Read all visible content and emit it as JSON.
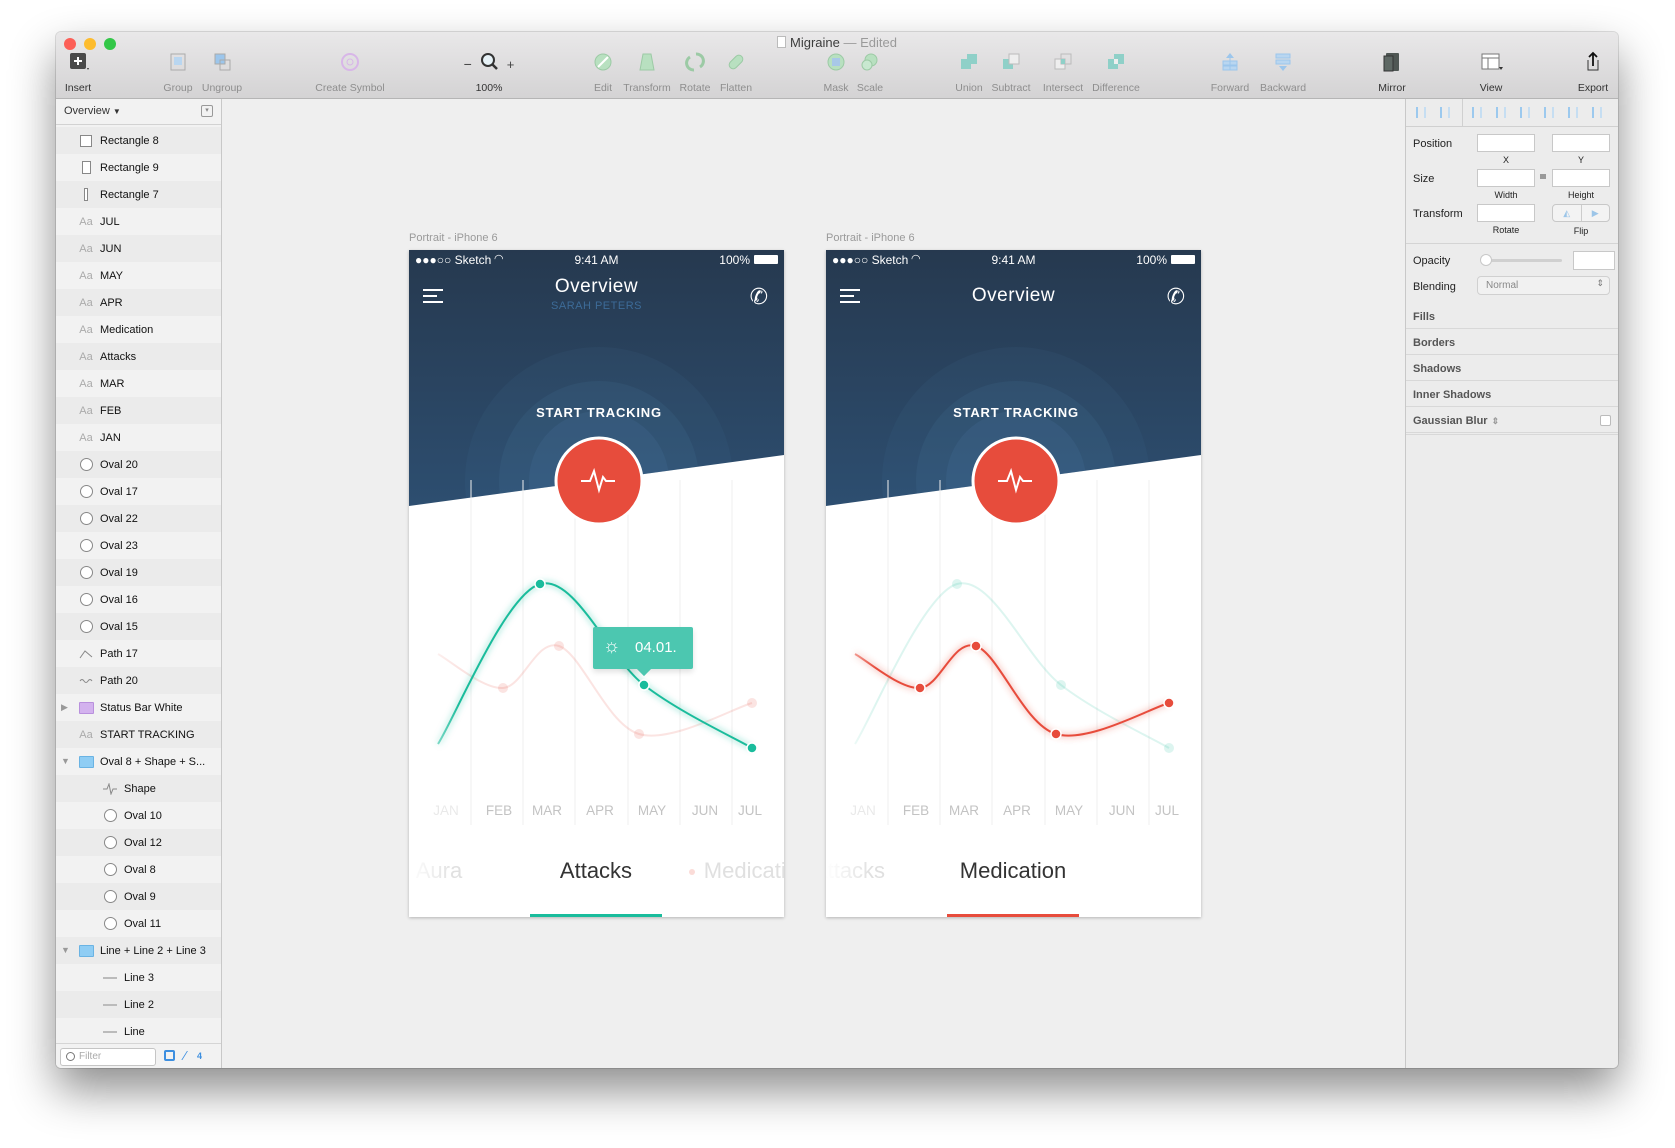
{
  "window": {
    "title": "Migraine",
    "status": "Edited",
    "separator": "—"
  },
  "toolbar": {
    "items": [
      {
        "label": "Insert",
        "icon": "insert-plus-icon",
        "enabled": true
      },
      {
        "label": "Group",
        "icon": "group-icon",
        "enabled": false
      },
      {
        "label": "Ungroup",
        "icon": "ungroup-icon",
        "enabled": false
      },
      {
        "label": "Create Symbol",
        "icon": "create-symbol-icon",
        "enabled": false
      },
      {
        "label": "100%",
        "icon": "zoom-icon",
        "enabled": true
      },
      {
        "label": "Edit",
        "icon": "edit-icon",
        "enabled": false
      },
      {
        "label": "Transform",
        "icon": "transform-icon",
        "enabled": false
      },
      {
        "label": "Rotate",
        "icon": "rotate-icon",
        "enabled": false
      },
      {
        "label": "Flatten",
        "icon": "flatten-icon",
        "enabled": false
      },
      {
        "label": "Mask",
        "icon": "mask-icon",
        "enabled": false
      },
      {
        "label": "Scale",
        "icon": "scale-icon",
        "enabled": false
      },
      {
        "label": "Union",
        "icon": "union-icon",
        "enabled": false
      },
      {
        "label": "Subtract",
        "icon": "subtract-icon",
        "enabled": false
      },
      {
        "label": "Intersect",
        "icon": "intersect-icon",
        "enabled": false
      },
      {
        "label": "Difference",
        "icon": "difference-icon",
        "enabled": false
      },
      {
        "label": "Forward",
        "icon": "forward-icon",
        "enabled": false
      },
      {
        "label": "Backward",
        "icon": "backward-icon",
        "enabled": false
      },
      {
        "label": "Mirror",
        "icon": "mirror-icon",
        "enabled": true
      },
      {
        "label": "View",
        "icon": "view-icon",
        "enabled": true
      },
      {
        "label": "Export",
        "icon": "export-icon",
        "enabled": true
      }
    ],
    "zoom_minus": "−",
    "zoom_plus": "+"
  },
  "layers": {
    "page": "Overview",
    "filter_placeholder": "Filter",
    "edit_count": "4",
    "items": [
      {
        "name": "Rectangle 8",
        "type": "rect-square",
        "level": 0
      },
      {
        "name": "Rectangle 9",
        "type": "rect-tall",
        "level": 0
      },
      {
        "name": "Rectangle 7",
        "type": "rect-thin",
        "level": 0
      },
      {
        "name": "JUL",
        "type": "text",
        "level": 0
      },
      {
        "name": "JUN",
        "type": "text",
        "level": 0
      },
      {
        "name": "MAY",
        "type": "text",
        "level": 0
      },
      {
        "name": "APR",
        "type": "text",
        "level": 0
      },
      {
        "name": "Medication",
        "type": "text",
        "level": 0
      },
      {
        "name": "Attacks",
        "type": "text",
        "level": 0
      },
      {
        "name": "MAR",
        "type": "text",
        "level": 0
      },
      {
        "name": "FEB",
        "type": "text",
        "level": 0
      },
      {
        "name": "JAN",
        "type": "text",
        "level": 0
      },
      {
        "name": "Oval 20",
        "type": "oval",
        "level": 0
      },
      {
        "name": "Oval 17",
        "type": "oval",
        "level": 0
      },
      {
        "name": "Oval 22",
        "type": "oval",
        "level": 0
      },
      {
        "name": "Oval 23",
        "type": "oval",
        "level": 0
      },
      {
        "name": "Oval 19",
        "type": "oval",
        "level": 0
      },
      {
        "name": "Oval 16",
        "type": "oval",
        "level": 0
      },
      {
        "name": "Oval 15",
        "type": "oval",
        "level": 0
      },
      {
        "name": "Path 17",
        "type": "path-peak",
        "level": 0
      },
      {
        "name": "Path 20",
        "type": "path-wave",
        "level": 0
      },
      {
        "name": "Status Bar White",
        "type": "folder-symbol",
        "level": 0,
        "expanded": false
      },
      {
        "name": "START TRACKING",
        "type": "text",
        "level": 0
      },
      {
        "name": "Oval 8 + Shape + S...",
        "type": "folder",
        "level": 0,
        "expanded": true
      },
      {
        "name": "Shape",
        "type": "pulse",
        "level": 1
      },
      {
        "name": "Oval 10",
        "type": "oval",
        "level": 1
      },
      {
        "name": "Oval 12",
        "type": "oval",
        "level": 1
      },
      {
        "name": "Oval 8",
        "type": "oval",
        "level": 1
      },
      {
        "name": "Oval 9",
        "type": "oval",
        "level": 1
      },
      {
        "name": "Oval 11",
        "type": "oval",
        "level": 1
      },
      {
        "name": "Line + Line 2 + Line 3",
        "type": "folder",
        "level": 0,
        "expanded": true
      },
      {
        "name": "Line 3",
        "type": "line",
        "level": 1
      },
      {
        "name": "Line 2",
        "type": "line",
        "level": 1
      },
      {
        "name": "Line",
        "type": "line",
        "level": 1
      }
    ]
  },
  "inspector": {
    "position": "Position",
    "x": "X",
    "y": "Y",
    "size": "Size",
    "width": "Width",
    "height": "Height",
    "transform": "Transform",
    "rotate": "Rotate",
    "flip": "Flip",
    "opacity": "Opacity",
    "opacity_value": 0,
    "blending": "Blending",
    "blending_value": "Normal",
    "sections": [
      "Fills",
      "Borders",
      "Shadows",
      "Inner Shadows",
      "Gaussian Blur"
    ]
  },
  "artboards": [
    {
      "label": "Portrait - iPhone 6",
      "carrier": "●●●○○ Sketch",
      "time": "9:41 AM",
      "battery": "100%",
      "title": "Overview",
      "subtitle": "SARAH PETERS",
      "cta": "START TRACKING",
      "months": [
        "JAN",
        "FEB",
        "MAR",
        "APR",
        "MAY",
        "JUN",
        "JUL"
      ],
      "tooltip": "04.01.",
      "active_series": "attacks",
      "tabs": [
        {
          "label": "Aura",
          "active": false
        },
        {
          "label": "Attacks",
          "active": true
        },
        {
          "label": "Medication",
          "active": false
        }
      ]
    },
    {
      "label": "Portrait - iPhone 6",
      "carrier": "●●●○○ Sketch",
      "time": "9:41 AM",
      "battery": "100%",
      "title": "Overview",
      "subtitle": "",
      "cta": "START TRACKING",
      "months": [
        "JAN",
        "FEB",
        "MAR",
        "APR",
        "MAY",
        "JUN",
        "JUL"
      ],
      "tooltip": "",
      "active_series": "medication",
      "tabs": [
        {
          "label": "Attacks",
          "active": false
        },
        {
          "label": "Medication",
          "active": true
        }
      ]
    }
  ],
  "colors": {
    "attacks": "#1abc9c",
    "medication": "#e74c3c",
    "header_top": "#26394f",
    "header_bottom": "#2d4e70",
    "tooltip": "#4cc7b0",
    "selection_blue": "#3d8fe0"
  }
}
